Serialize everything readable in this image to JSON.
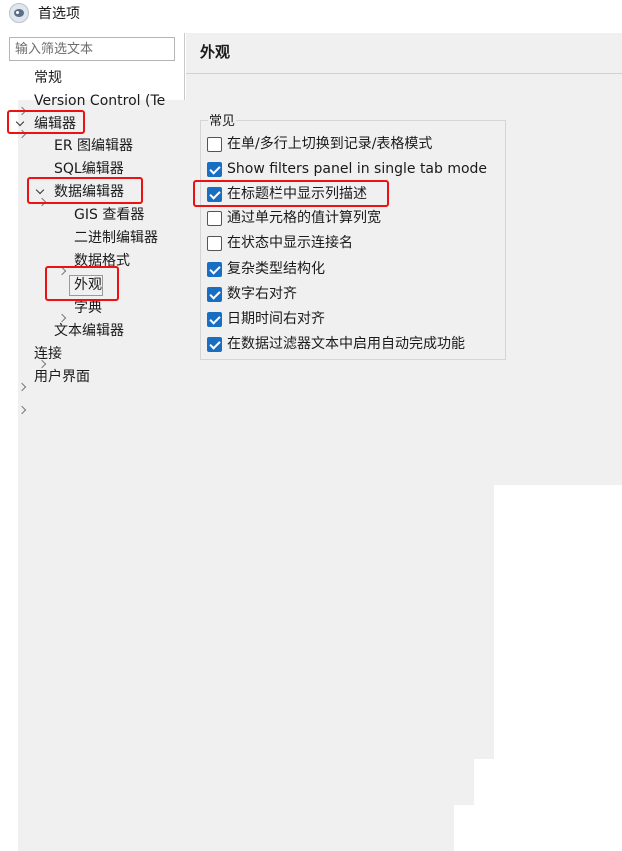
{
  "window": {
    "title": "首选项",
    "icon": "app-logo-icon"
  },
  "sidebar": {
    "filter_placeholder": "输入筛选文本",
    "items": [
      {
        "label": "常规"
      },
      {
        "label": "Version Control (Te"
      },
      {
        "label": "编辑器"
      },
      {
        "label": "ER 图编辑器"
      },
      {
        "label": "SQL编辑器"
      },
      {
        "label": "数据编辑器"
      },
      {
        "label": "GIS 查看器"
      },
      {
        "label": "二进制编辑器"
      },
      {
        "label": "数据格式"
      },
      {
        "label": "外观"
      },
      {
        "label": "字典"
      },
      {
        "label": "文本编辑器"
      },
      {
        "label": "连接"
      },
      {
        "label": "用户界面"
      }
    ],
    "selected": "外观"
  },
  "main": {
    "title": "外观",
    "group_label": "常见",
    "options": [
      {
        "label": "在单/多行上切换到记录/表格模式",
        "checked": false
      },
      {
        "label": "Show filters panel in single tab mode",
        "checked": true
      },
      {
        "label": "在标题栏中显示列描述",
        "checked": true
      },
      {
        "label": "通过单元格的值计算列宽",
        "checked": false
      },
      {
        "label": "在状态中显示连接名",
        "checked": false
      },
      {
        "label": "复杂类型结构化",
        "checked": true
      },
      {
        "label": "数字右对齐",
        "checked": true
      },
      {
        "label": "日期时间右对齐",
        "checked": true
      },
      {
        "label": "在数据过滤器文本中启用自动完成功能",
        "checked": true
      }
    ]
  },
  "colors": {
    "accent": "#1a6ec2",
    "highlight": "#ee1111",
    "panel_bg": "#f0f0f0"
  }
}
